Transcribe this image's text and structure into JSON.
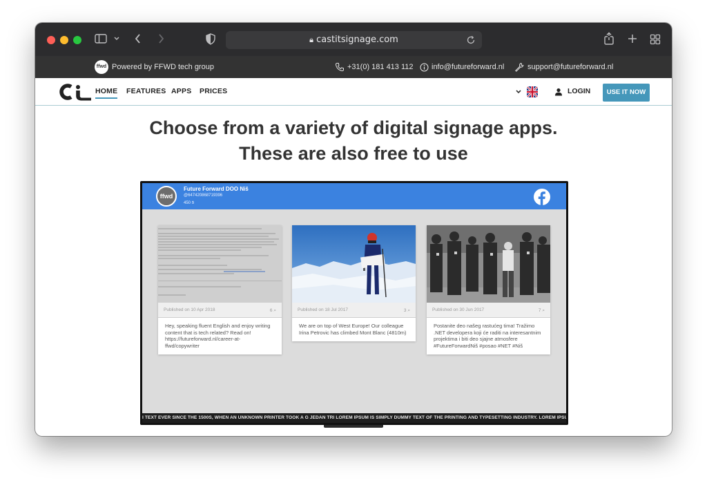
{
  "browser": {
    "url": "castitsignage.com",
    "colors": {
      "close": "#ff5f57",
      "minimize": "#febc2e",
      "maximize": "#28c840"
    }
  },
  "topbar": {
    "logo_text": "ffwd",
    "powered_by": "Powered by FFWD tech group",
    "phone": "+31(0) 181 413 112",
    "info_email": "info@futureforward.nl",
    "support_email": "support@futureforward.nl"
  },
  "nav": {
    "logo_text": "Ci",
    "items": [
      {
        "label": "HOME"
      },
      {
        "label": "FEATURES"
      },
      {
        "label": "APPS"
      },
      {
        "label": "PRICES"
      }
    ],
    "login_label": "LOGIN",
    "cta_label": "USE IT NOW",
    "accent": "#4597ba"
  },
  "hero": {
    "line1": "Choose from a variety of digital signage apps.",
    "line2": "These are also free to use"
  },
  "facebook_screen": {
    "page_name": "Future Forward DOO Niš",
    "page_id": "@647420868719396",
    "likes": "450",
    "avatar_text": "ffwd",
    "header_color": "#3b82e0",
    "posts": [
      {
        "date": "Published on 10 Apr 2018",
        "count": "6",
        "text": "Hey, speaking fluent English and enjoy writing content that is tech related? Read on! https://futureforward.nl/career-at-ffwd/copywriter"
      },
      {
        "date": "Published on 18 Jul 2017",
        "count": "3",
        "text": "We are on top of West Europe! Our colleague Irina Petrovic has climbed Mont Blanc (4810m)"
      },
      {
        "date": "Published on 30 Jun 2017",
        "count": "7",
        "text": "Postanite deo našeg rastućeg tima! Tražimo .NET developera koji će raditi na interesantnim projektima i biti deo sjajne atmosfere #FutureForwardNiš #posao #NET #Niš"
      }
    ],
    "ticker": "I TEXT EVER SINCE THE 1500S, WHEN AN UNKNOWN PRINTER TOOK A G  JEDAN   TRI   LOREM IPSUM IS SIMPLY DUMMY TEXT OF THE PRINTING AND TYPESETTING INDUSTRY. LOREM IPSUM HAS BE"
  }
}
